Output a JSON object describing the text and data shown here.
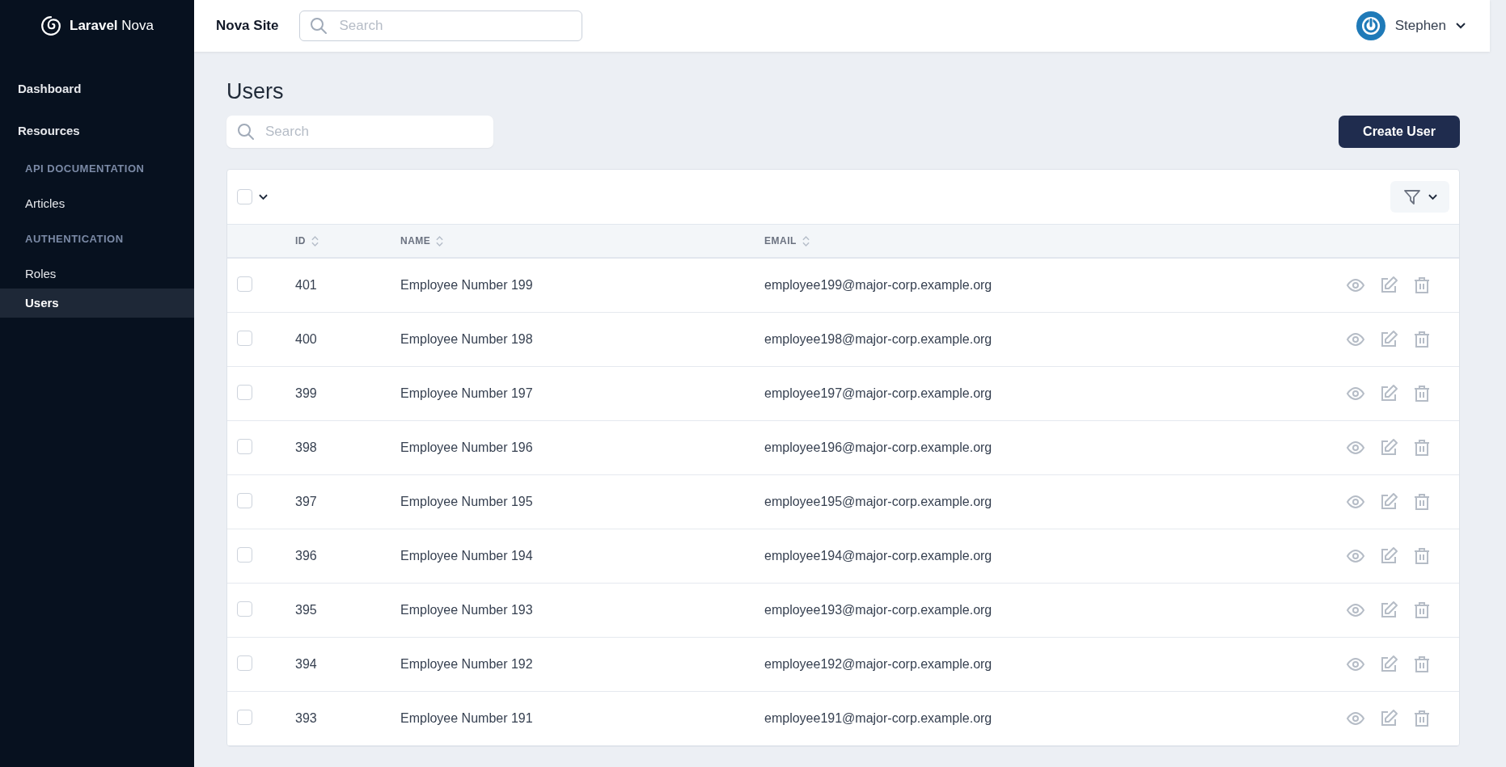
{
  "brand": {
    "name": "Laravel",
    "suffix": "Nova"
  },
  "topbar": {
    "site": "Nova Site",
    "search": {
      "placeholder": "Search"
    },
    "user": {
      "name": "Stephen"
    }
  },
  "sidebar": {
    "items": [
      {
        "kind": "section",
        "label": "Dashboard",
        "selected": false
      },
      {
        "kind": "section",
        "label": "Resources",
        "selected": false
      },
      {
        "kind": "group",
        "label": "API DOCUMENTATION",
        "selected": false
      },
      {
        "kind": "link",
        "label": "Articles",
        "selected": false
      },
      {
        "kind": "group",
        "label": "AUTHENTICATION",
        "selected": false
      },
      {
        "kind": "link",
        "label": "Roles",
        "selected": false
      },
      {
        "kind": "link",
        "label": "Users",
        "selected": true
      }
    ]
  },
  "page": {
    "title": "Users",
    "search": {
      "placeholder": "Search"
    },
    "create_button": "Create User"
  },
  "table": {
    "select_all": {
      "checked": false
    },
    "columns": [
      {
        "label": "ID"
      },
      {
        "label": "NAME"
      },
      {
        "label": "EMAIL"
      }
    ],
    "rows": [
      {
        "id": "401",
        "name": "Employee Number 199",
        "email": "employee199@major-corp.example.org",
        "checked": false
      },
      {
        "id": "400",
        "name": "Employee Number 198",
        "email": "employee198@major-corp.example.org",
        "checked": false
      },
      {
        "id": "399",
        "name": "Employee Number 197",
        "email": "employee197@major-corp.example.org",
        "checked": false
      },
      {
        "id": "398",
        "name": "Employee Number 196",
        "email": "employee196@major-corp.example.org",
        "checked": false
      },
      {
        "id": "397",
        "name": "Employee Number 195",
        "email": "employee195@major-corp.example.org",
        "checked": false
      },
      {
        "id": "396",
        "name": "Employee Number 194",
        "email": "employee194@major-corp.example.org",
        "checked": false
      },
      {
        "id": "395",
        "name": "Employee Number 193",
        "email": "employee193@major-corp.example.org",
        "checked": false
      },
      {
        "id": "394",
        "name": "Employee Number 192",
        "email": "employee192@major-corp.example.org",
        "checked": false
      },
      {
        "id": "393",
        "name": "Employee Number 191",
        "email": "employee191@major-corp.example.org",
        "checked": false
      }
    ]
  }
}
